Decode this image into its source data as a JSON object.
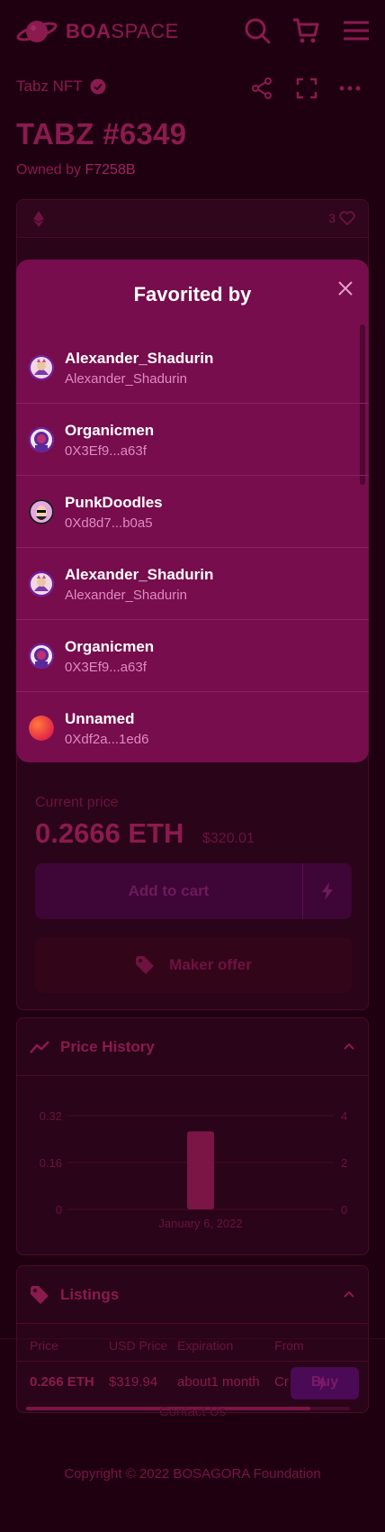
{
  "header": {
    "brand_bold": "BOA",
    "brand_light": "SPACE",
    "icons": [
      "search-icon",
      "cart-icon",
      "menu-icon"
    ]
  },
  "nft": {
    "collection": "Tabz NFT",
    "title": "TABZ #6349",
    "owner_prefix": "Owned by ",
    "owner": "F7258B",
    "favorites_count": "3"
  },
  "pricing": {
    "label": "Current price",
    "value": "0.2666 ETH",
    "usd": "$320.01",
    "add_to_cart": "Add to cart",
    "make_offer": "Maker offer"
  },
  "price_history": {
    "title": "Price History"
  },
  "chart_data": {
    "type": "bar",
    "categories": [
      "January 6, 2022"
    ],
    "values": [
      0.2666
    ],
    "y_left_ticks": [
      "0.32",
      "0.16",
      "0"
    ],
    "y_right_ticks": [
      "4",
      "2",
      "0"
    ],
    "ylim": [
      0,
      0.32
    ],
    "grid": true
  },
  "listings": {
    "title": "Listings",
    "columns": [
      "Price",
      "USD Price",
      "Expiration",
      "From"
    ],
    "rows": [
      {
        "price": "0.266 ETH",
        "usd": "$319.94",
        "expiration": "about1 month",
        "from": "Cr",
        "buy": "Buy"
      }
    ]
  },
  "footer": {
    "contact": "Contact Us",
    "copyright": "Copyright © 2022 BOSAGORA Foundation"
  },
  "modal": {
    "title": "Favorited by",
    "users": [
      {
        "name": "Alexander_Shadurin",
        "address": "Alexander_Shadurin",
        "avatar": "cat-avatar"
      },
      {
        "name": "Organicmen",
        "address": "0X3Ef9...a63f",
        "avatar": "astronaut-avatar"
      },
      {
        "name": "PunkDoodles",
        "address": "0Xd8d7...b0a5",
        "avatar": "punk-avatar"
      },
      {
        "name": "Alexander_Shadurin",
        "address": "Alexander_Shadurin",
        "avatar": "cat-avatar"
      },
      {
        "name": "Organicmen",
        "address": "0X3Ef9...a63f",
        "avatar": "astronaut-avatar"
      },
      {
        "name": "Unnamed",
        "address": "0Xdf2a...1ed6",
        "avatar": "gradient-avatar"
      }
    ]
  },
  "colors": {
    "background": "#1f0011",
    "modal": "#770d4d",
    "accent": "#8b1a4f"
  }
}
